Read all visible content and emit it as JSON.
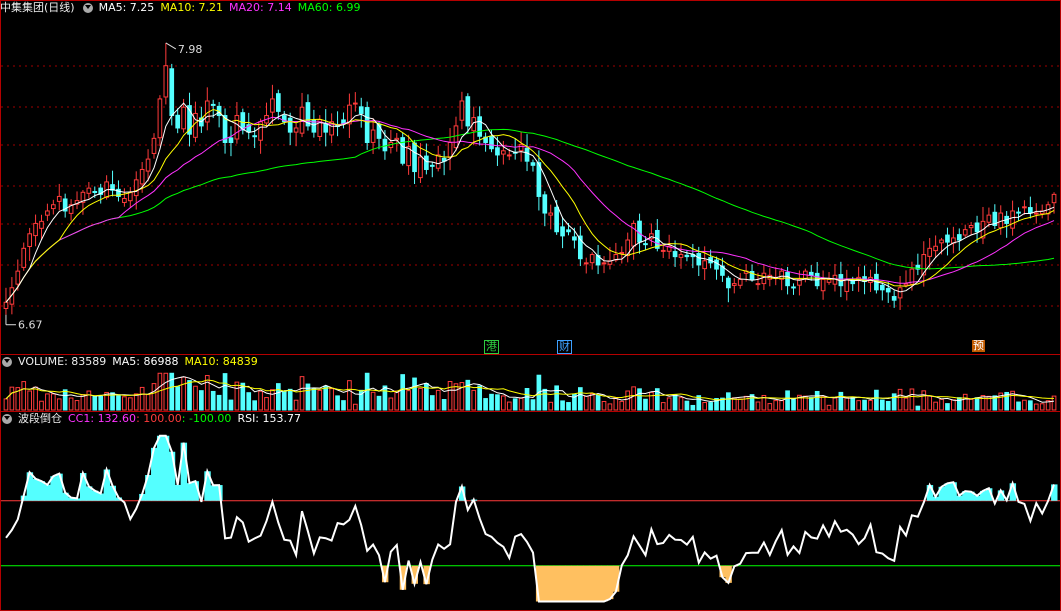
{
  "panels": {
    "price": {
      "title": "中集集团(日线)",
      "ma5_label": "MA5: 7.25",
      "ma10_label": "MA10: 7.21",
      "ma20_label": "MA20: 7.14",
      "ma60_label": "MA60: 6.99",
      "high_label": "7.98",
      "low_label": "6.67"
    },
    "volume": {
      "title": "VOLUME: 83589",
      "ma5_label": "MA5: 86988",
      "ma10_label": "MA10: 84839"
    },
    "indicator": {
      "title": "波段倒仓",
      "cc1_label": "CC1: 132.60",
      "v2_label": ": 100.00",
      "v3_label": ": -100.00",
      "rsi_label": "RSI: 153.77"
    }
  },
  "events": [
    {
      "label": "港",
      "color": "#2ecc40"
    },
    {
      "label": "财",
      "color": "#3da0ff"
    },
    {
      "label": "预",
      "color": "#ff6a00"
    }
  ],
  "colors": {
    "up": "#ff3b3b",
    "down": "#54ffff",
    "ma5": "#ffffff",
    "ma10": "#ffff00",
    "ma20": "#ff33ff",
    "ma60": "#00ff00",
    "border": "#b40000"
  },
  "chart_data": {
    "type": "candlestick",
    "ylim": [
      6.5,
      8.1
    ],
    "closes": [
      6.73,
      6.8,
      6.88,
      6.99,
      7.06,
      7.11,
      7.12,
      7.17,
      7.2,
      7.24,
      7.17,
      7.2,
      7.22,
      7.26,
      7.28,
      7.26,
      7.25,
      7.31,
      7.27,
      7.24,
      7.23,
      7.26,
      7.32,
      7.37,
      7.42,
      7.52,
      7.71,
      7.87,
      7.63,
      7.57,
      7.67,
      7.54,
      7.64,
      7.58,
      7.7,
      7.68,
      7.63,
      7.5,
      7.5,
      7.63,
      7.56,
      7.55,
      7.53,
      7.6,
      7.63,
      7.71,
      7.65,
      7.6,
      7.55,
      7.57,
      7.67,
      7.58,
      7.55,
      7.61,
      7.55,
      7.6,
      7.58,
      7.59,
      7.68,
      7.69,
      7.64,
      7.5,
      7.56,
      7.52,
      7.46,
      7.5,
      7.52,
      7.4,
      7.48,
      7.36,
      7.43,
      7.37,
      7.39,
      7.44,
      7.41,
      7.5,
      7.58,
      7.7,
      7.58,
      7.62,
      7.53,
      7.5,
      7.47,
      7.44,
      7.46,
      7.44,
      7.45,
      7.49,
      7.41,
      7.39,
      7.24,
      7.16,
      7.16,
      7.07,
      7.05,
      7.07,
      7.03,
      6.94,
      6.92,
      6.96,
      6.91,
      6.92,
      6.93,
      6.96,
      6.97,
      7.03,
      7.11,
      7.02,
      7.01,
      7.06,
      6.99,
      6.98,
      7.0,
      6.95,
      6.96,
      6.95,
      6.95,
      6.91,
      6.93,
      6.92,
      6.89,
      6.86,
      6.8,
      6.82,
      6.84,
      6.88,
      6.84,
      6.82,
      6.87,
      6.86,
      6.85,
      6.88,
      6.81,
      6.8,
      6.84,
      6.88,
      6.86,
      6.81,
      6.84,
      6.84,
      6.86,
      6.81,
      6.84,
      6.82,
      6.85,
      6.83,
      6.85,
      6.79,
      6.79,
      6.78,
      6.74,
      6.8,
      6.82,
      6.89,
      6.89,
      6.96,
      6.99,
      7.0,
      7.03,
      7.02,
      7.04,
      7.03,
      7.08,
      7.1,
      7.07,
      7.12,
      7.15,
      7.1,
      7.16,
      7.11,
      7.17,
      7.16,
      7.19,
      7.16,
      7.16,
      7.17,
      7.2,
      7.25
    ],
    "high": 7.98,
    "low": 6.67,
    "volume_ylim": [
      0,
      300000
    ],
    "indicator_ylim": [
      -230,
      330
    ]
  }
}
